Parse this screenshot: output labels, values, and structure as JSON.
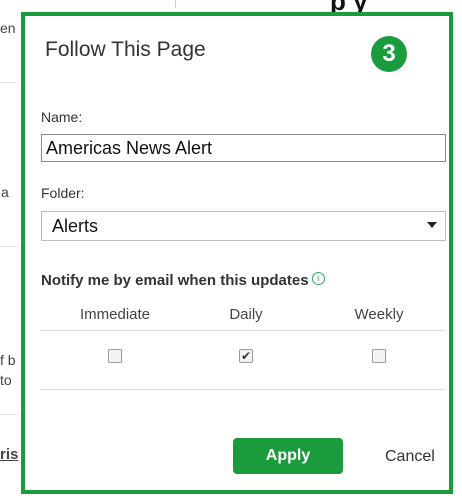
{
  "background": {
    "fragments": [
      "en",
      "a",
      "f b",
      "to",
      "ris"
    ],
    "top_text": "p y"
  },
  "popup": {
    "title": "Follow This Page",
    "step_number": "3",
    "name_label": "Name:",
    "name_value": "Americas News Alert",
    "folder_label": "Folder:",
    "folder_value": "Alerts",
    "notify_label": "Notify me by email when this updates",
    "info_icon": "i",
    "frequency": {
      "options": [
        "Immediate",
        "Daily",
        "Weekly"
      ],
      "checked": [
        false,
        true,
        false
      ]
    },
    "apply_label": "Apply",
    "cancel_label": "Cancel"
  },
  "colors": {
    "accent": "#1a9b3c"
  }
}
